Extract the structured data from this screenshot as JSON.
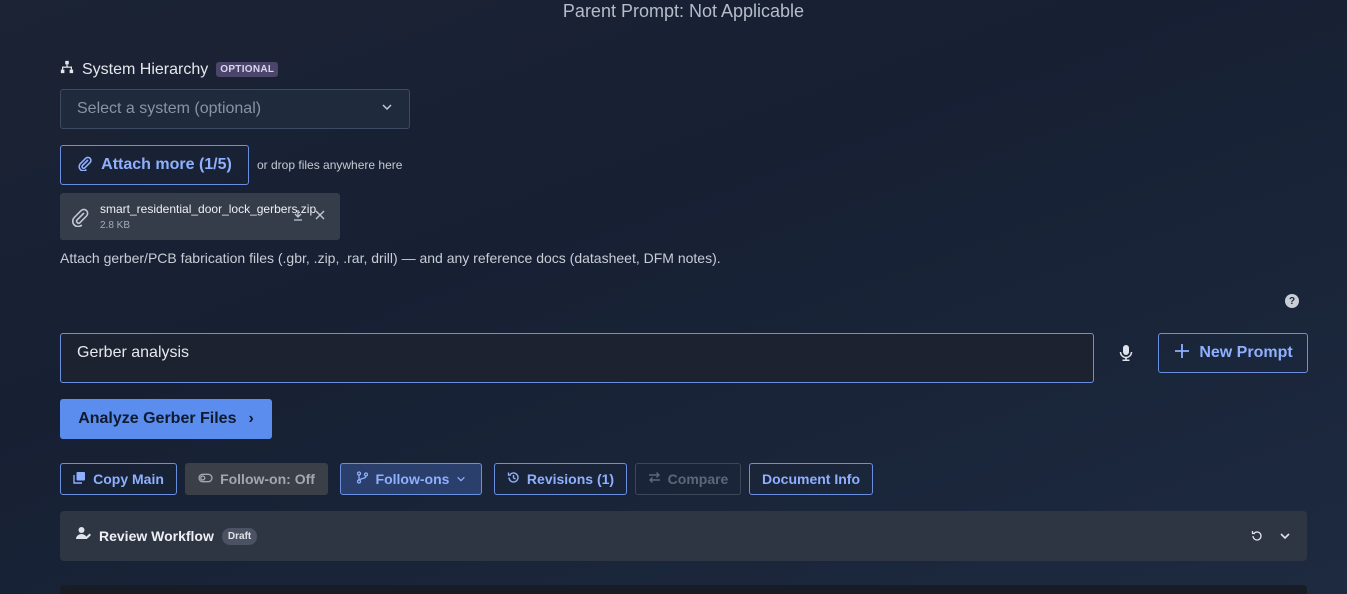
{
  "header": {
    "parent_prompt": "Parent Prompt: Not Applicable"
  },
  "system_hierarchy": {
    "label": "System Hierarchy",
    "badge": "OPTIONAL",
    "select_placeholder": "Select a system (optional)",
    "icon": "sitemap-icon"
  },
  "attachments": {
    "attach_label": "Attach more (1/5)",
    "drop_hint": "or drop files anywhere here",
    "file": {
      "name": "smart_residential_door_lock_gerbers.zip",
      "size": "2.8 KB"
    },
    "help_text": "Attach gerber/PCB fabrication files (.gbr, .zip, .rar, drill) — and any reference docs (datasheet, DFM notes)."
  },
  "help_icon": "?",
  "prompt": {
    "value": "Gerber analysis",
    "new_prompt_label": "New Prompt",
    "analyze_label": "Analyze Gerber Files",
    "analyze_chevron": "›"
  },
  "toolbar": {
    "copy_main": "Copy Main",
    "follow_on_toggle": "Follow-on: Off",
    "follow_ons": "Follow-ons",
    "revisions": "Revisions (1)",
    "compare": "Compare",
    "document_info": "Document Info"
  },
  "workflow": {
    "title": "Review Workflow",
    "badge": "Draft"
  },
  "colors": {
    "accent": "#5b8def",
    "accent_text": "#8fb0ff",
    "background": "#1b2334",
    "panel": "#2e3644"
  }
}
